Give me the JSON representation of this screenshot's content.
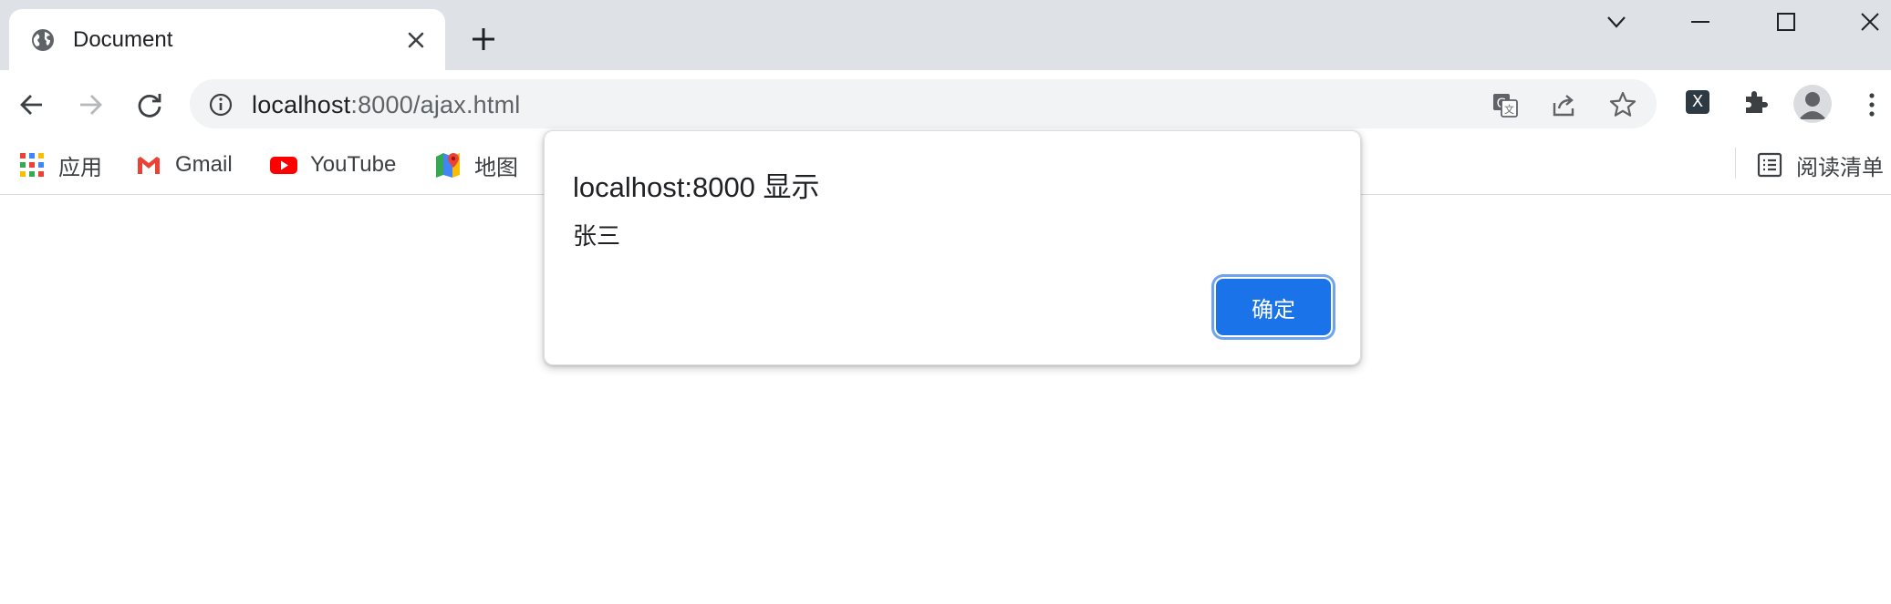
{
  "tab": {
    "title": "Document"
  },
  "address_bar": {
    "host": "localhost",
    "path": ":8000/ajax.html"
  },
  "bookmarks": {
    "items": [
      {
        "label": "应用",
        "icon": "apps-grid-icon"
      },
      {
        "label": "Gmail",
        "icon": "gmail-icon"
      },
      {
        "label": "YouTube",
        "icon": "youtube-icon"
      },
      {
        "label": "地图",
        "icon": "maps-icon"
      }
    ],
    "reading_list": "阅读清单"
  },
  "dialog": {
    "title": "localhost:8000 显示",
    "message": "张三",
    "ok_label": "确定"
  },
  "colors": {
    "tabstrip_bg": "#dee1e6",
    "omnibox_bg": "#f1f3f4",
    "accent": "#1a73e8",
    "youtube_red": "#ff0000",
    "gmail_red": "#ea4335"
  }
}
